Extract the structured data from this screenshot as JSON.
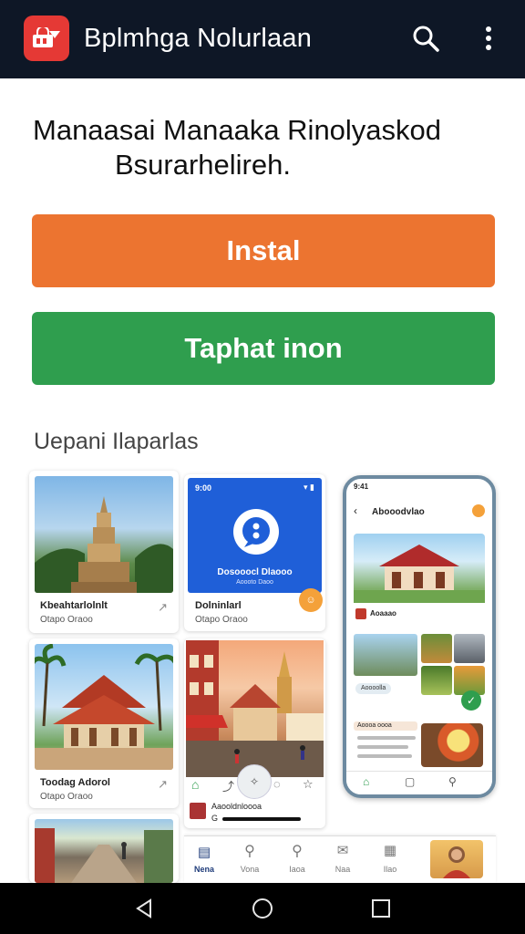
{
  "appbar": {
    "title": "Bplmhga Nolurlaan",
    "logo_icon": "store-bag-icon",
    "search_icon": "search-icon",
    "more_icon": "more-vert-icon",
    "background": "#0e1726",
    "logo_color": "#e53935"
  },
  "headline": {
    "line1": "Manaasai Manaaka Rinolyaskod",
    "line2": "Bsurarhelireh."
  },
  "buttons": {
    "install_label": "Instal",
    "secondary_label": "Taphat inon",
    "install_color": "#ec7430",
    "secondary_color": "#2f9e4e"
  },
  "gallery": {
    "title": "Uepani Ilaparlas",
    "card1": {
      "caption": "Kbeahtarlolnlt",
      "sub": "Otapo Oraoo"
    },
    "card2": {
      "caption": "Toodag Adorol",
      "sub": "Otapo Oraoo"
    },
    "card3": {
      "caption": "Dolninlarl",
      "sub": "Otapo Oraoo"
    },
    "blue_card_text": "Dosooocl Dlaooo",
    "blue_card_sub": "Aoooto Daoo",
    "strip_caption": "Aaooldnloooa",
    "strip_sub": "G",
    "bottom_tabs": [
      "Nena",
      "Vona",
      "Iaoa",
      "Naa",
      "Ilao"
    ],
    "phone": {
      "title": "Abooodvlao",
      "chip_label": "Aoooolla",
      "row_label_1": "Aoaaao",
      "row_label_2": "Aoooa oooa"
    }
  },
  "system_nav": {
    "back_icon": "back-triangle-icon",
    "home_icon": "home-circle-icon",
    "recents_icon": "recents-square-icon"
  }
}
